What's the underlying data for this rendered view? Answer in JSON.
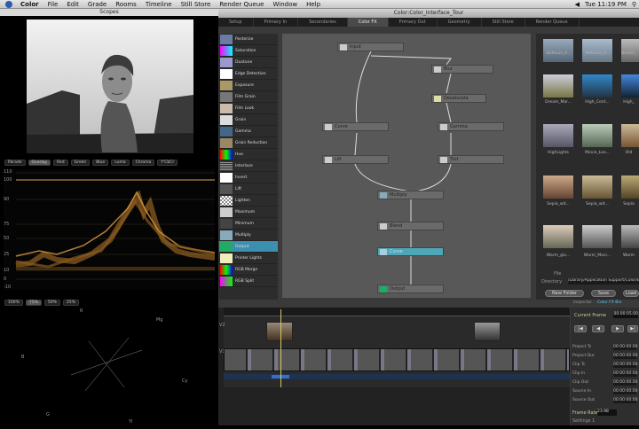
{
  "menubar": {
    "app": "Color",
    "items": [
      "File",
      "Edit",
      "Grade",
      "Rooms",
      "Timeline",
      "Still Store",
      "Render Queue",
      "Window",
      "Help"
    ],
    "clock": "Tue 11:19 PM"
  },
  "scopes": {
    "title": "Scopes",
    "buttons": [
      "Parade",
      "Overlay",
      "Red",
      "Green",
      "Blue",
      "Luma",
      "Chroma",
      "Y'CbCr"
    ],
    "wf_labels": [
      "110",
      "100",
      "90",
      "75",
      "50",
      "25",
      "10",
      "0",
      "-10"
    ],
    "scale_buttons": [
      "100%",
      "75%",
      "50%",
      "25%"
    ],
    "vec_labels": [
      "R",
      "Mg",
      "B",
      "Cy",
      "G",
      "Yl"
    ]
  },
  "window": {
    "title": "Color:Color_Interface_Tour",
    "tabs": [
      "Setup",
      "Primary In",
      "Secondaries",
      "Color FX",
      "Primary Out",
      "Geometry",
      "Still Store",
      "Render Queue"
    ],
    "active_tab": "Color FX"
  },
  "nodelist": {
    "items": [
      "Posterize",
      "Saturation",
      "Duotone",
      "Edge Detection",
      "Exposure",
      "Film Grain",
      "Film Look",
      "Grain",
      "Gamma",
      "Grain Reduction",
      "Hue",
      "Interlace",
      "Invert",
      "Lift",
      "Lighten",
      "Maximum",
      "Minimum",
      "Multiply",
      "Output",
      "Printer Lights",
      "RGB Merge",
      "RGB Split"
    ],
    "selected": "Output"
  },
  "nodes": {
    "n1": "Input",
    "n2": "Blur",
    "n3": "Desaturate",
    "n4": "Curve",
    "n5": "Gamma",
    "n6": "Lift",
    "n7": "Tint",
    "n8": "Multiply",
    "n9": "Blend",
    "n10": "Curve",
    "n11": "Output"
  },
  "browser": {
    "thumbs": [
      "Defocus_V...",
      "Defocus_V...",
      "Dream_",
      "Dream_Mar...",
      "High_Cont...",
      "High_",
      "HighLights",
      "Movie_Loo...",
      "Old",
      "Sepia_wit...",
      "Sepia_wit...",
      "Sepia",
      "Warm_glo...",
      "Warm_Movi...",
      "Warm"
    ],
    "file_label": "File",
    "directory_label": "Directory",
    "directory_value": "/Library/Application Support/Color/Effects",
    "new_folder": "New Folder",
    "save": "Save",
    "load": "Load"
  },
  "inspector": {
    "tabs": [
      "Inspector",
      "Color FX Bin"
    ],
    "current_frame_label": "Current Frame",
    "current_frame_value": "00:00:05:00",
    "fields": [
      {
        "label": "Project Tc",
        "value": "00:00:00:00"
      },
      {
        "label": "Project Dur",
        "value": "00:00:00:00"
      },
      {
        "label": "Clip Tc",
        "value": "00:00:00:00"
      },
      {
        "label": "Clip In",
        "value": "00:00:00:00"
      },
      {
        "label": "Clip Out",
        "value": "00:00:00:00"
      },
      {
        "label": "Source In",
        "value": "00:00:00:00"
      },
      {
        "label": "Source Out",
        "value": "00:00:00:00"
      }
    ],
    "frame_rate_label": "Frame Rate",
    "frame_rate_value": "23.98",
    "settings_label": "Settings 1"
  },
  "timeline": {
    "tracks": [
      "V1",
      "V2"
    ]
  }
}
